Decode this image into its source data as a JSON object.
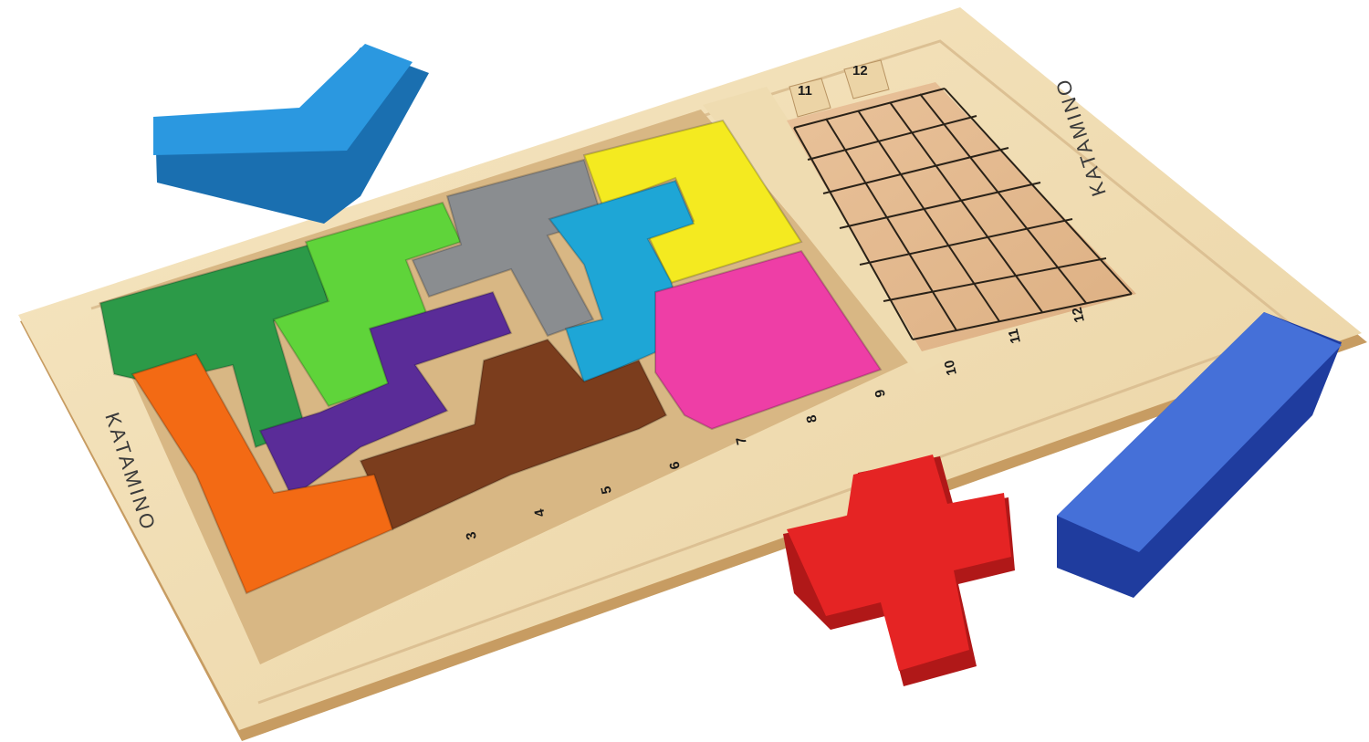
{
  "brand": {
    "left_label": "KATAMINO",
    "right_label": "KATAMINO"
  },
  "board": {
    "wood_color": "#f1deb4",
    "grid_color": "#e3b88a",
    "bottom_slot_numbers": [
      "3",
      "4",
      "5",
      "6",
      "7",
      "8",
      "9",
      "10"
    ],
    "right_slot_numbers": [
      "11",
      "12"
    ],
    "top_slot_numbers": [
      "11",
      "12"
    ],
    "grid": {
      "columns": 5,
      "rows": 6
    }
  },
  "pieces": {
    "on_board": [
      {
        "name": "dark-green-piece",
        "color": "#2c9a48"
      },
      {
        "name": "light-green-piece",
        "color": "#5fd43a"
      },
      {
        "name": "gray-piece",
        "color": "#8a8d90"
      },
      {
        "name": "yellow-piece",
        "color": "#f4ea20"
      },
      {
        "name": "cyan-piece",
        "color": "#1ea6d6"
      },
      {
        "name": "magenta-piece",
        "color": "#ee3ea6"
      },
      {
        "name": "purple-piece",
        "color": "#5a2c98"
      },
      {
        "name": "brown-piece",
        "color": "#7b3d1d"
      },
      {
        "name": "orange-piece",
        "color": "#f36a14"
      }
    ],
    "loose": [
      {
        "name": "blue-l-piece",
        "color": "#1f8fd8"
      },
      {
        "name": "red-cross-piece",
        "color": "#e01e1e"
      },
      {
        "name": "navy-bar-piece",
        "color": "#2c56c4"
      }
    ]
  }
}
